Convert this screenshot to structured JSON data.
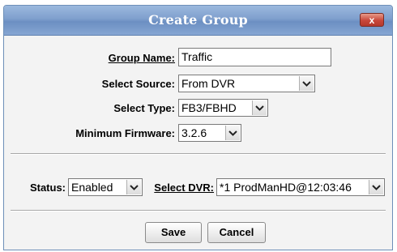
{
  "dialog": {
    "title": "Create Group",
    "close_glyph": "x",
    "close_icon": "close-icon"
  },
  "form": {
    "group_name_label": "Group Name:",
    "group_name_value": "Traffic",
    "source_label": "Select Source:",
    "source_value": "From DVR",
    "type_label": "Select Type:",
    "type_value": "FB3/FBHD",
    "firmware_label": "Minimum Firmware:",
    "firmware_value": "3.2.6",
    "status_label": "Status:",
    "status_value": "Enabled",
    "dvr_label": "Select DVR:",
    "dvr_value": "*1 ProdManHD@12:03:46"
  },
  "buttons": {
    "save": "Save",
    "cancel": "Cancel"
  },
  "colors": {
    "titlebar": "#7f9fcd",
    "close_button": "#c8473a",
    "background": "#f3f3f3"
  }
}
